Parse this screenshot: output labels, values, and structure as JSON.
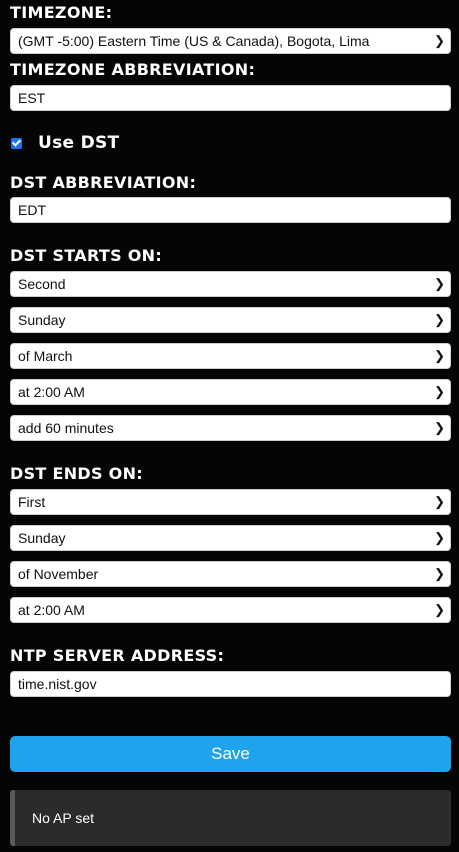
{
  "timezone": {
    "label": "TIMEZONE:",
    "selected": "(GMT -5:00) Eastern Time (US & Canada), Bogota, Lima"
  },
  "tz_abbrev": {
    "label": "TIMEZONE ABBREVIATION:",
    "value": "EST"
  },
  "use_dst": {
    "label": "Use DST",
    "checked": true
  },
  "dst_abbrev": {
    "label": "DST ABBREVIATION:",
    "value": "EDT"
  },
  "dst_start": {
    "label": "DST STARTS ON:",
    "week": "Second",
    "day": "Sunday",
    "month": "of March",
    "time": "at 2:00 AM",
    "offset": "add 60 minutes"
  },
  "dst_end": {
    "label": "DST ENDS ON:",
    "week": "First",
    "day": "Sunday",
    "month": "of November",
    "time": "at 2:00 AM"
  },
  "ntp": {
    "label": "NTP SERVER ADDRESS:",
    "value": "time.nist.gov"
  },
  "save_label": "Save",
  "status_message": "No AP set",
  "colors": {
    "accent": "#1fa3ec",
    "background": "#050505",
    "message_bg": "#2b2b2b"
  },
  "icons": {
    "select": "chevron-down-icon",
    "checkbox": "checkmark-icon"
  }
}
